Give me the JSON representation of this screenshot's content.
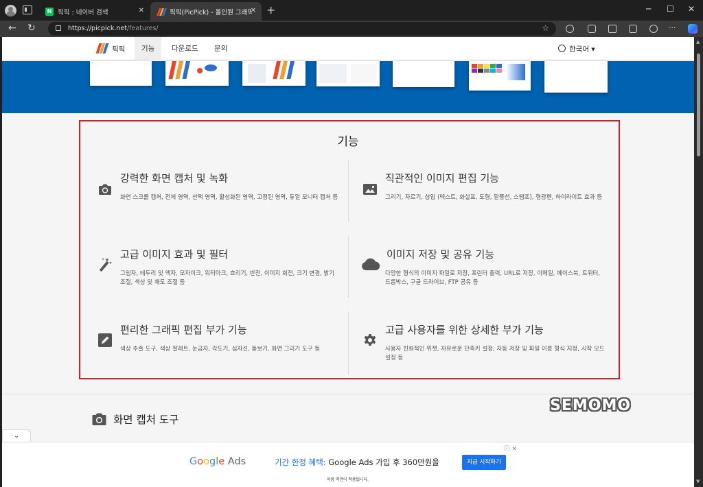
{
  "browser": {
    "tabs": [
      {
        "title": "픽픽 : 네이버 검색",
        "favicon": "naver-icon"
      },
      {
        "title": "픽픽(PicPick) - 올인원 그래픽 디자인 도구",
        "favicon": "picpick-icon"
      }
    ],
    "url_host": "https://picpick.net",
    "url_path": "/features/"
  },
  "site": {
    "brand": "픽픽",
    "nav": [
      "기능",
      "다운로드",
      "문의"
    ],
    "language": "한국어",
    "logo_colors": [
      "#e8452c",
      "#f0a030",
      "#2c6fd1"
    ]
  },
  "features": {
    "title": "기능",
    "items": [
      {
        "icon": "camera-icon",
        "title": "강력한 화면 캡처 및 녹화",
        "desc": "화면 스크롤 캡처, 전체 영역, 선택 영역, 활성화된 영역, 고정된 영역, 듀얼 모니터 캡처 등"
      },
      {
        "icon": "image-icon",
        "title": "직관적인 이미지 편집 기능",
        "desc": "그리기, 자르기, 삽입 (텍스트, 화살표, 도형, 말풍선, 스탬프), 형광펜, 하이라이트 효과 등"
      },
      {
        "icon": "magic-wand-icon",
        "title": "고급 이미지 효과 및 필터",
        "desc": "그림자, 테두리 및 액자, 모자이크, 워터마크, 흐리기, 반전, 이미지 회전, 크기 변경, 밝기 조절, 색상 및 채도 조절 등"
      },
      {
        "icon": "cloud-icon",
        "title": "이미지 저장 및 공유 기능",
        "desc": "다양한 형식의 이미지 파일로 저장, 프린터 출력, URL로 저장, 이메일, 페이스북, 트위터, 드롭박스, 구글 드라이브, FTP 공유 등"
      },
      {
        "icon": "pencil-icon",
        "title": "편리한 그래픽 편집 부가 기능",
        "desc": "색상 추출 도구, 색상 팔레트, 눈금자, 각도기, 십자선, 돋보기, 화면 그리기 도구 등"
      },
      {
        "icon": "gear-icon",
        "title": "고급 사용자를 위한 상세한 부가 기능",
        "desc": "사용자 친화적인 위젯, 자유로운 단축키 설정, 자동 저장 및 파일 이름 형식 지정, 시작 모드 설정 등"
      }
    ]
  },
  "section": {
    "icon": "camera-icon",
    "title": "화면 캡처 도구"
  },
  "watermark": "SEMOMO",
  "ad": {
    "brand_parts": [
      "G",
      "o",
      "o",
      "g",
      "l",
      "e",
      " Ads"
    ],
    "headline_prefix": "기간 한정 혜택:",
    "headline": " Google Ads 가입 후 360만원을",
    "cta": "지금 시작하기",
    "small": "이용 약관이 적용됩니다."
  },
  "colors": {
    "hero": "#0062b1",
    "highlight": "#e21b23",
    "cta": "#1a73e8"
  }
}
